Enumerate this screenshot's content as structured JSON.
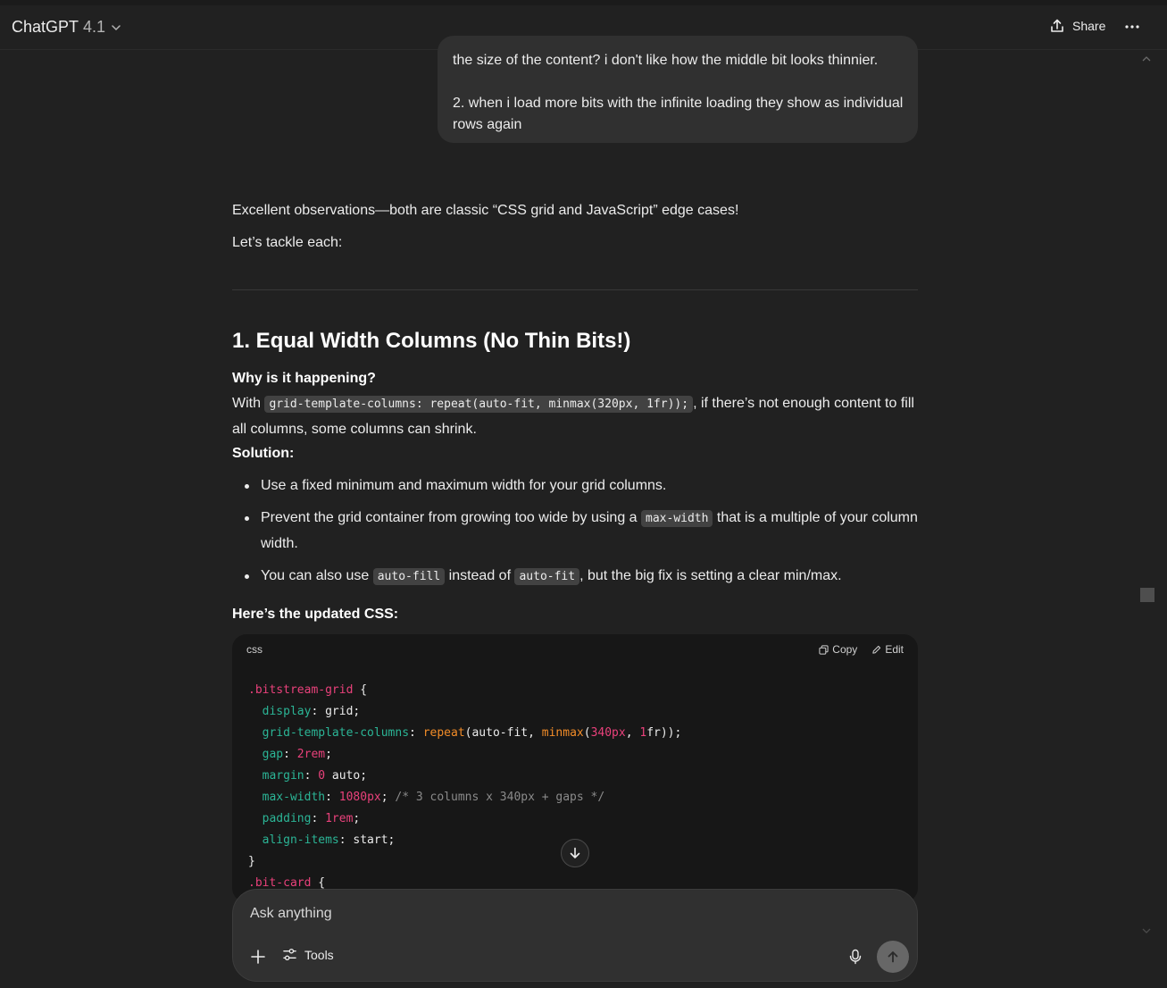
{
  "header": {
    "model_name": "ChatGPT",
    "model_version": "4.1",
    "share_label": "Share"
  },
  "user_message": {
    "line1": "the size of the content? i don't like how the middle bit looks thinnier.",
    "line2": "2. when i load more bits with the infinite loading they show as individual rows again"
  },
  "assistant": {
    "intro1": "Excellent observations—both are classic “CSS grid and JavaScript” edge cases!",
    "intro2": "Let’s tackle each:",
    "heading": "1. Equal Width Columns (No Thin Bits!)",
    "why": "Why is it happening?",
    "with_prefix": "With ",
    "with_code": "grid-template-columns: repeat(auto-fit, minmax(320px, 1fr));",
    "with_suffix": ", if there’s not enough content to fill all columns, some columns can shrink.",
    "solution": "Solution:",
    "bullet1": "Use a fixed minimum and maximum width for your grid columns.",
    "bullet2_prefix": "Prevent the grid container from growing too wide by using a ",
    "bullet2_code": "max-width",
    "bullet2_suffix": " that is a multiple of your column width.",
    "bullet3_prefix": "You can also use ",
    "bullet3_code1": "auto-fill",
    "bullet3_mid": " instead of ",
    "bullet3_code2": "auto-fit",
    "bullet3_suffix": ", but the big fix is setting a clear min/max.",
    "updated": "Here’s the updated CSS:"
  },
  "codeblock": {
    "language": "css",
    "copy_label": "Copy",
    "edit_label": "Edit",
    "lines": {
      "l1_sel": ".bitstream-grid",
      "l1_rest": " {",
      "l2_prop": "display",
      "l2_val": "grid",
      "l3_prop": "grid-template-columns",
      "l3_fn1": "repeat",
      "l3_arg1": "auto-fit, ",
      "l3_fn2": "minmax",
      "l3_num1": "340px",
      "l3_num2": "1",
      "l3_tail": "fr));",
      "l4_prop": "gap",
      "l4_num": "2rem",
      "l5_prop": "margin",
      "l5_num": "0",
      "l5_val": " auto;",
      "l6_prop": "max-width",
      "l6_num": "1080px",
      "l6_comment": "/* 3 columns x 340px + gaps */",
      "l7_prop": "padding",
      "l7_num": "1rem",
      "l8_prop": "align-items",
      "l8_val": "start",
      "l9": "}",
      "l10_sel": ".bit-card",
      "l10_rest": " {"
    }
  },
  "composer": {
    "placeholder": "Ask anything",
    "tools_label": "Tools"
  },
  "icons": {
    "model_chevron": "chevron-down-icon",
    "share": "share-icon",
    "more": "more-horizontal-icon",
    "copy": "copy-icon",
    "edit": "edit-icon",
    "scroll_down": "arrow-down-icon",
    "plus": "plus-icon",
    "tools": "sliders-icon",
    "mic": "microphone-icon",
    "send": "arrow-up-icon"
  }
}
